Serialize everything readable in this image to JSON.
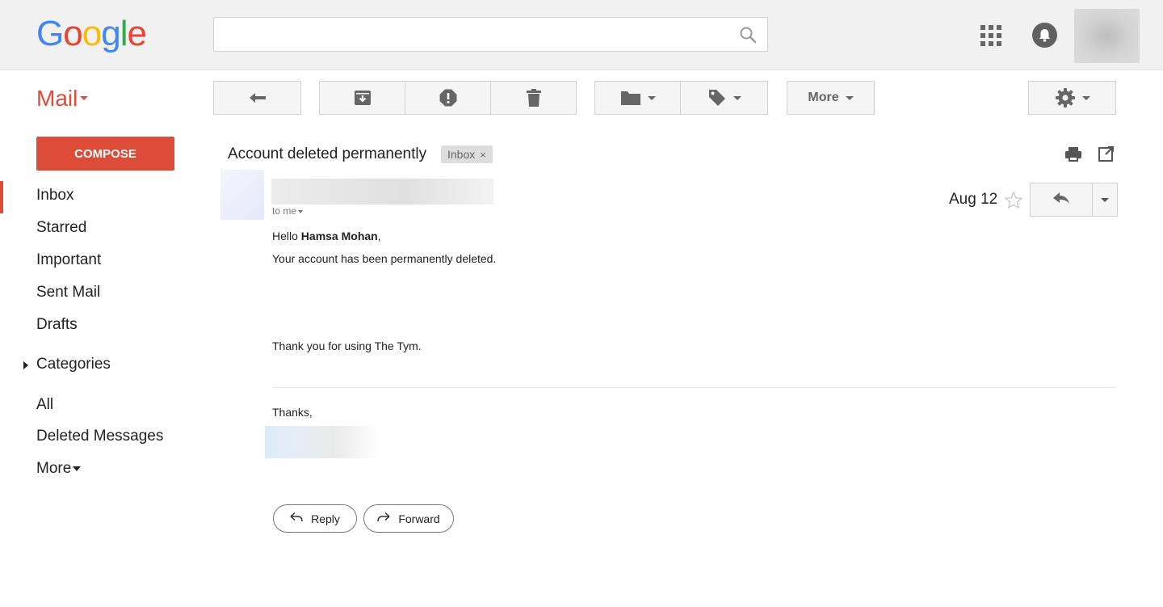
{
  "header": {
    "logo_letters": [
      {
        "char": "G",
        "color": "#4285f4"
      },
      {
        "char": "o",
        "color": "#ea4335"
      },
      {
        "char": "o",
        "color": "#fbbc05"
      },
      {
        "char": "g",
        "color": "#4285f4"
      },
      {
        "char": "l",
        "color": "#34a853"
      },
      {
        "char": "e",
        "color": "#ea4335"
      }
    ],
    "search_value": "",
    "icons": [
      "search-icon",
      "apps-grid-icon",
      "notifications-bell-icon",
      "account-avatar"
    ]
  },
  "app_label": "Mail",
  "toolbar": {
    "more_label": "More",
    "icons": [
      "back-arrow-icon",
      "archive-icon",
      "report-spam-icon",
      "delete-trash-icon",
      "move-to-folder-icon",
      "labels-tag-icon",
      "settings-gear-icon"
    ]
  },
  "sidebar": {
    "compose_label": "COMPOSE",
    "items": [
      {
        "label": "Inbox",
        "active": true
      },
      {
        "label": "Starred"
      },
      {
        "label": "Important"
      },
      {
        "label": "Sent Mail"
      },
      {
        "label": "Drafts"
      },
      {
        "label": "Categories"
      },
      {
        "label": "All"
      },
      {
        "label": "Deleted Messages"
      },
      {
        "label": "More"
      }
    ]
  },
  "message": {
    "subject": "Account deleted permanently",
    "label_chip": "Inbox",
    "label_chip_remove": "×",
    "recipient": "to me",
    "date": "Aug 12",
    "greeting_prefix": "Hello ",
    "greeting_name": "Hamsa Mohan",
    "greeting_suffix": ",",
    "body_line": "Your account has been permanently deleted.",
    "thanks_line": "Thank you for using The Tym.",
    "signoff": "Thanks,",
    "reply_label": "Reply",
    "forward_label": "Forward"
  },
  "colors": {
    "accent_red": "#dd4b39",
    "topbar_bg": "#f1f1f1",
    "button_bg": "#f5f5f5"
  }
}
